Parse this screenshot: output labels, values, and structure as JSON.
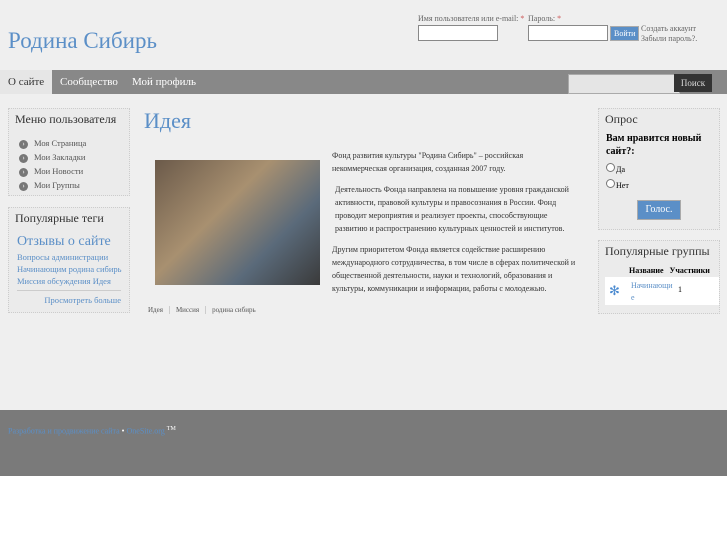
{
  "site_title": "Родина Сибирь",
  "login": {
    "username_label": "Имя пользователя или e-mail:",
    "password_label": "Пароль:",
    "required": "*",
    "submit": "Войти",
    "create_account": "Создать аккаунт",
    "forgot_password": "Забыли пароль?."
  },
  "nav": {
    "items": [
      "О сайте",
      "Сообщество",
      "Мой профиль"
    ],
    "search_button": "Поиск"
  },
  "user_menu": {
    "title": "Меню пользователя",
    "items": [
      "Моя Страница",
      "Мои Закладки",
      "Мои Новости",
      "Мои Группы"
    ]
  },
  "tags": {
    "title": "Популярные теги",
    "featured": "Отзывы о сайте",
    "items": [
      "Вопросы администрации",
      "Начинающим родина сибирь",
      "Миссия обсуждения Идея"
    ],
    "more": "Просмотреть больше"
  },
  "article": {
    "title": "Идея",
    "paragraphs": [
      "Фонд развития культуры \"Родина Сибирь\" – российская некоммерческая организация, созданная  2007 году.",
      "Деятельность Фонда направлена на повышение уровня гражданской активности, правовой культуры и правосознания в России. Фонд проводит мероприятия и реализует проекты, способствующие развитию и распространению культурных ценностей и институтов.",
      "Другим приоритетом Фонда является содействие расширению международного сотрудничества, в том числе в сферах политической и общественной деятельности, науки и технологий, образования и культуры, коммуникации и информации, работы с молодежью."
    ],
    "tags": [
      "Идея",
      "Миссия",
      "родина сибирь"
    ]
  },
  "poll": {
    "title": "Опрос",
    "question": "Вам нравится новый сайт?:",
    "options": [
      "Да",
      "Нет"
    ],
    "vote": "Голос."
  },
  "groups": {
    "title": "Популярные группы",
    "col_name": "Название",
    "col_members": "Участники",
    "rows": [
      {
        "name": "Начинающие",
        "members": "1"
      }
    ]
  },
  "footer": {
    "text": "Разработка и продвижение сайта",
    "sep": "•",
    "link": "OneSite.org",
    "tm": "TM"
  }
}
